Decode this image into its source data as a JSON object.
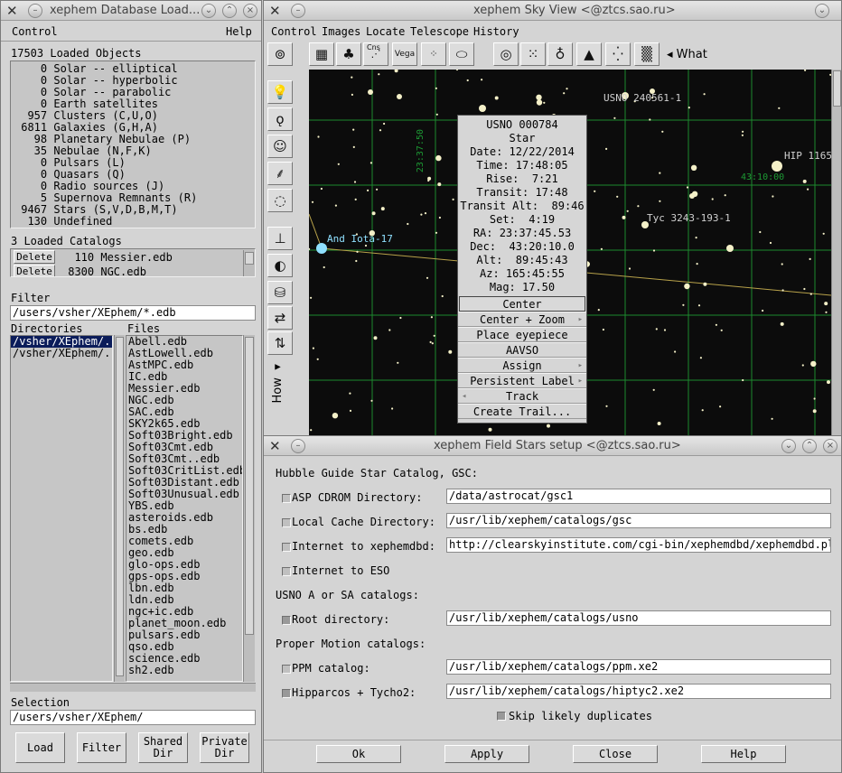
{
  "db_window": {
    "title": "xephem Database Load...",
    "menu": {
      "control": "Control",
      "help": "Help"
    },
    "loaded_objects_header": "17503 Loaded Objects",
    "object_counts": [
      "    0 Solar -- elliptical",
      "    0 Solar -- hyperbolic",
      "    0 Solar -- parabolic",
      "    0 Earth satellites",
      "  957 Clusters (C,U,O)",
      " 6811 Galaxies (G,H,A)",
      "   98 Planetary Nebulae (P)",
      "   35 Nebulae (N,F,K)",
      "    0 Pulsars (L)",
      "    0 Quasars (Q)",
      "    0 Radio sources (J)",
      "    5 Supernova Remnants (R)",
      " 9467 Stars (S,V,D,B,M,T)",
      "  130 Undefined"
    ],
    "catalogs_header": "3 Loaded Catalogs",
    "catalogs": [
      {
        "button": "Delete",
        "text": "  110 Messier.edb"
      },
      {
        "button": "Delete",
        "text": " 8300 NGC.edb"
      }
    ],
    "filter_label": "Filter",
    "filter_value": "/users/vsher/XEphem/*.edb",
    "directories_label": "Directories",
    "files_label": "Files",
    "directories": [
      "/vsher/XEphem/.",
      "/vsher/XEphem/.."
    ],
    "files": [
      "Abell.edb",
      "AstLowell.edb",
      "AstMPC.edb",
      "IC.edb",
      "Messier.edb",
      "NGC.edb",
      "SAC.edb",
      "SKY2k65.edb",
      "Soft03Bright.edb",
      "Soft03Cmt.edb",
      "Soft03Cmt..edb",
      "Soft03CritList.edb",
      "Soft03Distant.edb",
      "Soft03Unusual.edb",
      "YBS.edb",
      "asteroids.edb",
      "bs.edb",
      "comets.edb",
      "geo.edb",
      "glo-ops.edb",
      "gps-ops.edb",
      "lbn.edb",
      "ldn.edb",
      "ngc+ic.edb",
      "planet_moon.edb",
      "pulsars.edb",
      "qso.edb",
      "science.edb",
      "sh2.edb"
    ],
    "selection_label": "Selection",
    "selection_value": "/users/vsher/XEphem/",
    "buttons": {
      "load": "Load",
      "filter": "Filter",
      "shared_dir": "Shared\nDir",
      "private_dir": "Private\nDir"
    }
  },
  "sky_window": {
    "title": "xephem Sky View <@ztcs.sao.ru>",
    "menu": [
      "Control",
      "Images",
      "Locate",
      "Telescope",
      "History"
    ],
    "what_label": "What",
    "how_label": "How",
    "sky_labels": {
      "usno_overlap": "USNO 240561",
      "usno_overlap_suffix": "-1",
      "hip": "HIP 11652",
      "ra_grid": "23:37:50",
      "dec_grid": "43:10:00",
      "tyc": "Tyc 3243-193-1",
      "and_iota": "And Iota-17"
    },
    "popup": {
      "info": [
        "USNO 000784",
        "Star",
        "Date: 12/22/2014",
        "Time: 17:48:05",
        "Rise:  7:21",
        "Transit: 17:48",
        "Transit Alt:  89:46",
        "Set:  4:19",
        "RA: 23:37:45.53",
        "Dec:  43:20:10.0",
        "Alt:  89:45:43",
        "Az: 165:45:55",
        "Mag: 17.50"
      ],
      "items": [
        "Center",
        "Center + Zoom",
        "Place eyepiece",
        "AAVSO",
        "Assign",
        "Persistent Label",
        "Track",
        "Create Trail..."
      ]
    },
    "toolbar_icons": [
      "camera-icon",
      "grid-icon",
      "tree-icon",
      "constellation-icon",
      "vega-icon",
      "magnitude-dots-icon",
      "galaxy-ellipse-icon",
      "target-icon",
      "dots-icon",
      "nebula-icon",
      "eagle-icon",
      "scatter-icon",
      "noise-icon"
    ],
    "toolbar_text": {
      "cns": "Cns",
      "vega": "Vega"
    }
  },
  "field_window": {
    "title": "xephem Field Stars setup <@ztcs.sao.ru>",
    "gsc_header": "Hubble Guide Star Catalog, GSC:",
    "rows": [
      {
        "label": "ASP CDROM Directory:",
        "value": "/data/astrocat/gsc1",
        "checked": false
      },
      {
        "label": "Local Cache Directory:",
        "value": "/usr/lib/xephem/catalogs/gsc",
        "checked": false
      },
      {
        "label": "Internet to xephemdbd:",
        "value": "http://clearskyinstitute.com/cgi-bin/xephemdbd/xephemdbd.pl",
        "checked": false
      },
      {
        "label": "Internet to ESO",
        "value": "",
        "checked": false
      }
    ],
    "usno_header": "USNO A or SA catalogs:",
    "usno_row": {
      "label": "Root directory:",
      "value": "/usr/lib/xephem/catalogs/usno",
      "checked": true
    },
    "pm_header": "Proper Motion catalogs:",
    "pm_rows": [
      {
        "label": "PPM catalog:",
        "value": "/usr/lib/xephem/catalogs/ppm.xe2",
        "checked": false
      },
      {
        "label": "Hipparcos + Tycho2:",
        "value": "/usr/lib/xephem/catalogs/hiptyc2.xe2",
        "checked": true
      }
    ],
    "skip_label": "Skip likely duplicates",
    "buttons": {
      "ok": "Ok",
      "apply": "Apply",
      "close": "Close",
      "help": "Help"
    }
  }
}
